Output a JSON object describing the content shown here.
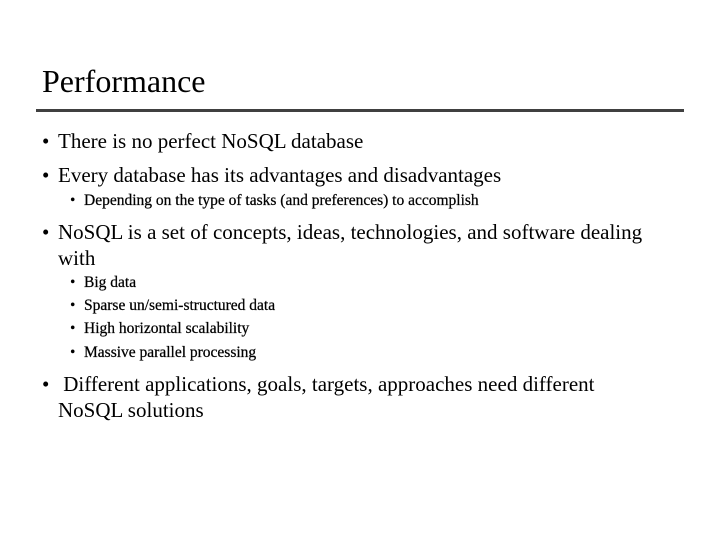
{
  "slide": {
    "title": "Performance",
    "bullet_glyph": "•",
    "sub_bullet_glyph": "•",
    "bullets": [
      {
        "text": "There is no perfect NoSQL database",
        "children": []
      },
      {
        "text": "Every database has its advantages and disadvantages",
        "children": [
          "Depending on the type of tasks (and preferences) to accomplish"
        ]
      },
      {
        "text": "NoSQL is a set of concepts, ideas, technologies, and software dealing with",
        "children": [
          "Big data",
          "Sparse un/semi-structured data",
          "High horizontal scalability",
          "Massive parallel processing"
        ]
      },
      {
        "text": " Different applications, goals, targets, approaches need different NoSQL solutions",
        "children": []
      }
    ]
  }
}
